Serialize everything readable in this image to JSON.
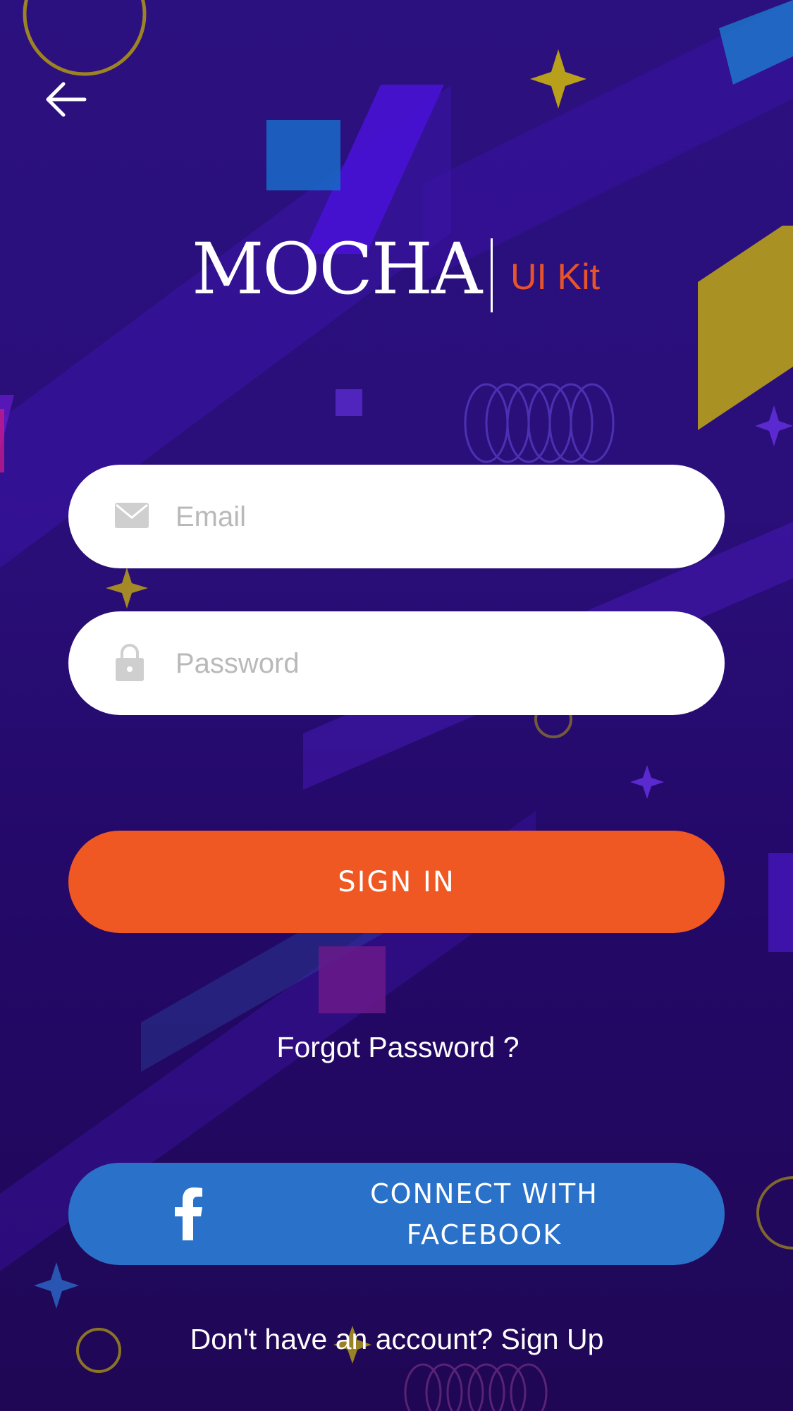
{
  "app": {
    "logo_main": "MOCHA",
    "logo_sub": "UI Kit"
  },
  "form": {
    "email_placeholder": "Email",
    "email_value": "",
    "password_placeholder": "Password",
    "password_value": ""
  },
  "actions": {
    "signin_label": "SIGN IN",
    "forgot_label": "Forgot Password ?",
    "facebook_label": "CONNECT WITH FACEBOOK",
    "signup_label": "Don't have an account? Sign Up"
  },
  "icons": {
    "back": "arrow-left-icon",
    "email": "envelope-icon",
    "password": "lock-icon",
    "facebook": "facebook-icon"
  },
  "colors": {
    "background": "#2a0f7e",
    "accent": "#ef5822",
    "facebook": "#2a72c9",
    "logo_sub": "#e8542a"
  }
}
